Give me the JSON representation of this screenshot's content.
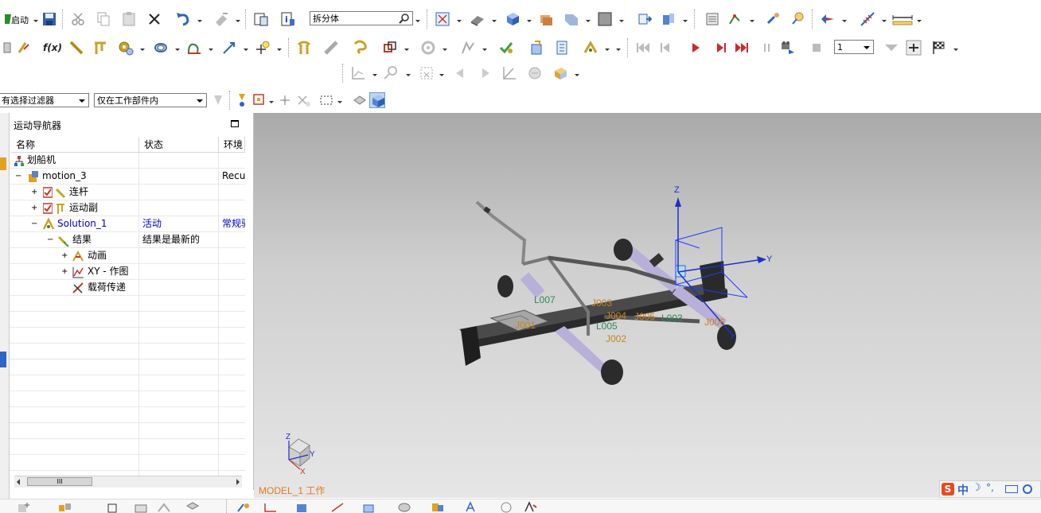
{
  "toolbar1": {
    "start_label": "启动",
    "filter_box_value": "拆分体"
  },
  "toolbar2": {
    "fx_label": "f(x)",
    "frame_value": "1"
  },
  "selbar": {
    "type_filter": "有选择过滤器",
    "scope_filter": "仅在工作部件内"
  },
  "navigator": {
    "title": "运动导航器",
    "columns": [
      "名称",
      "状态",
      "环境"
    ],
    "rows": [
      {
        "name": "划船机",
        "status": "",
        "env": ""
      },
      {
        "name": "motion_3",
        "status": "",
        "env": "Recu"
      },
      {
        "name": "连杆",
        "status": "",
        "env": ""
      },
      {
        "name": "运动副",
        "status": "",
        "env": ""
      },
      {
        "name": "Solution_1",
        "status": "活动",
        "env": "常规驱"
      },
      {
        "name": "结果",
        "status": "结果是最新的",
        "env": ""
      },
      {
        "name": "动画",
        "status": "",
        "env": ""
      },
      {
        "name": "XY - 作图",
        "status": "",
        "env": ""
      },
      {
        "name": "载荷传递",
        "status": "",
        "env": ""
      }
    ],
    "scroll_thumb": "III"
  },
  "viewport": {
    "model_label": "MODEL_1 工作",
    "axes": {
      "z": "Z",
      "y": "Y",
      "x": "X"
    },
    "labels": {
      "l007": "L007",
      "l005": "L005",
      "l003": "L003",
      "j002": "J002",
      "j005": "J005",
      "j004": "J004",
      "j003": "J003",
      "j006": "J006",
      "j001": "J001"
    }
  },
  "ime": {
    "logo": "S",
    "lang": "中",
    "moon": "☽",
    "dot": "°,"
  },
  "colors": {
    "viewport_top": "#a9a9a9",
    "viewport_bottom": "#e6e6e6",
    "model_label": "#e07a20",
    "link_label": "#2e8b57",
    "joint_label": "#c8841e",
    "active_text": "#0000cc"
  }
}
